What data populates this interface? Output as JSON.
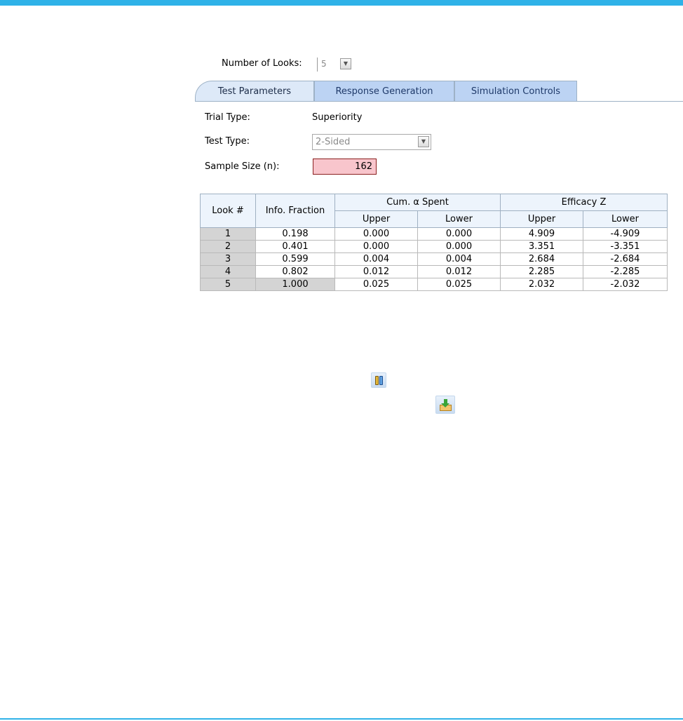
{
  "looks": {
    "label": "Number of Looks:",
    "value": "5"
  },
  "tabs": [
    {
      "label": "Test Parameters",
      "active": true
    },
    {
      "label": "Response Generation",
      "active": false
    },
    {
      "label": "Simulation Controls",
      "active": false
    }
  ],
  "params": {
    "trial_type_label": "Trial Type:",
    "trial_type_value": "Superiority",
    "test_type_label": "Test Type:",
    "test_type_value": "2-Sided",
    "sample_size_label": "Sample Size (n):",
    "sample_size_value": "162"
  },
  "table": {
    "headers": {
      "look": "Look #",
      "info": "Info. Fraction",
      "alpha_group": "Cum. α Spent",
      "efficacy_group": "Efficacy Z",
      "upper": "Upper",
      "lower": "Lower"
    },
    "rows": [
      [
        "1",
        "0.198",
        "0.000",
        "0.000",
        "4.909",
        "-4.909"
      ],
      [
        "2",
        "0.401",
        "0.000",
        "0.000",
        "3.351",
        "-3.351"
      ],
      [
        "3",
        "0.599",
        "0.004",
        "0.004",
        "2.684",
        "-2.684"
      ],
      [
        "4",
        "0.802",
        "0.012",
        "0.012",
        "2.285",
        "-2.285"
      ],
      [
        "5",
        "1.000",
        "0.025",
        "0.025",
        "2.032",
        "-2.032"
      ]
    ]
  },
  "icons": {
    "pause": "pause-icon",
    "download": "download-icon",
    "dropdown": "chevron-down-icon"
  },
  "colors": {
    "accent": "#2fb2e8",
    "sample_size_fill": "#f8c5cc",
    "active_tab": "#dde9f8",
    "inactive_tab": "#bcd3f3"
  }
}
